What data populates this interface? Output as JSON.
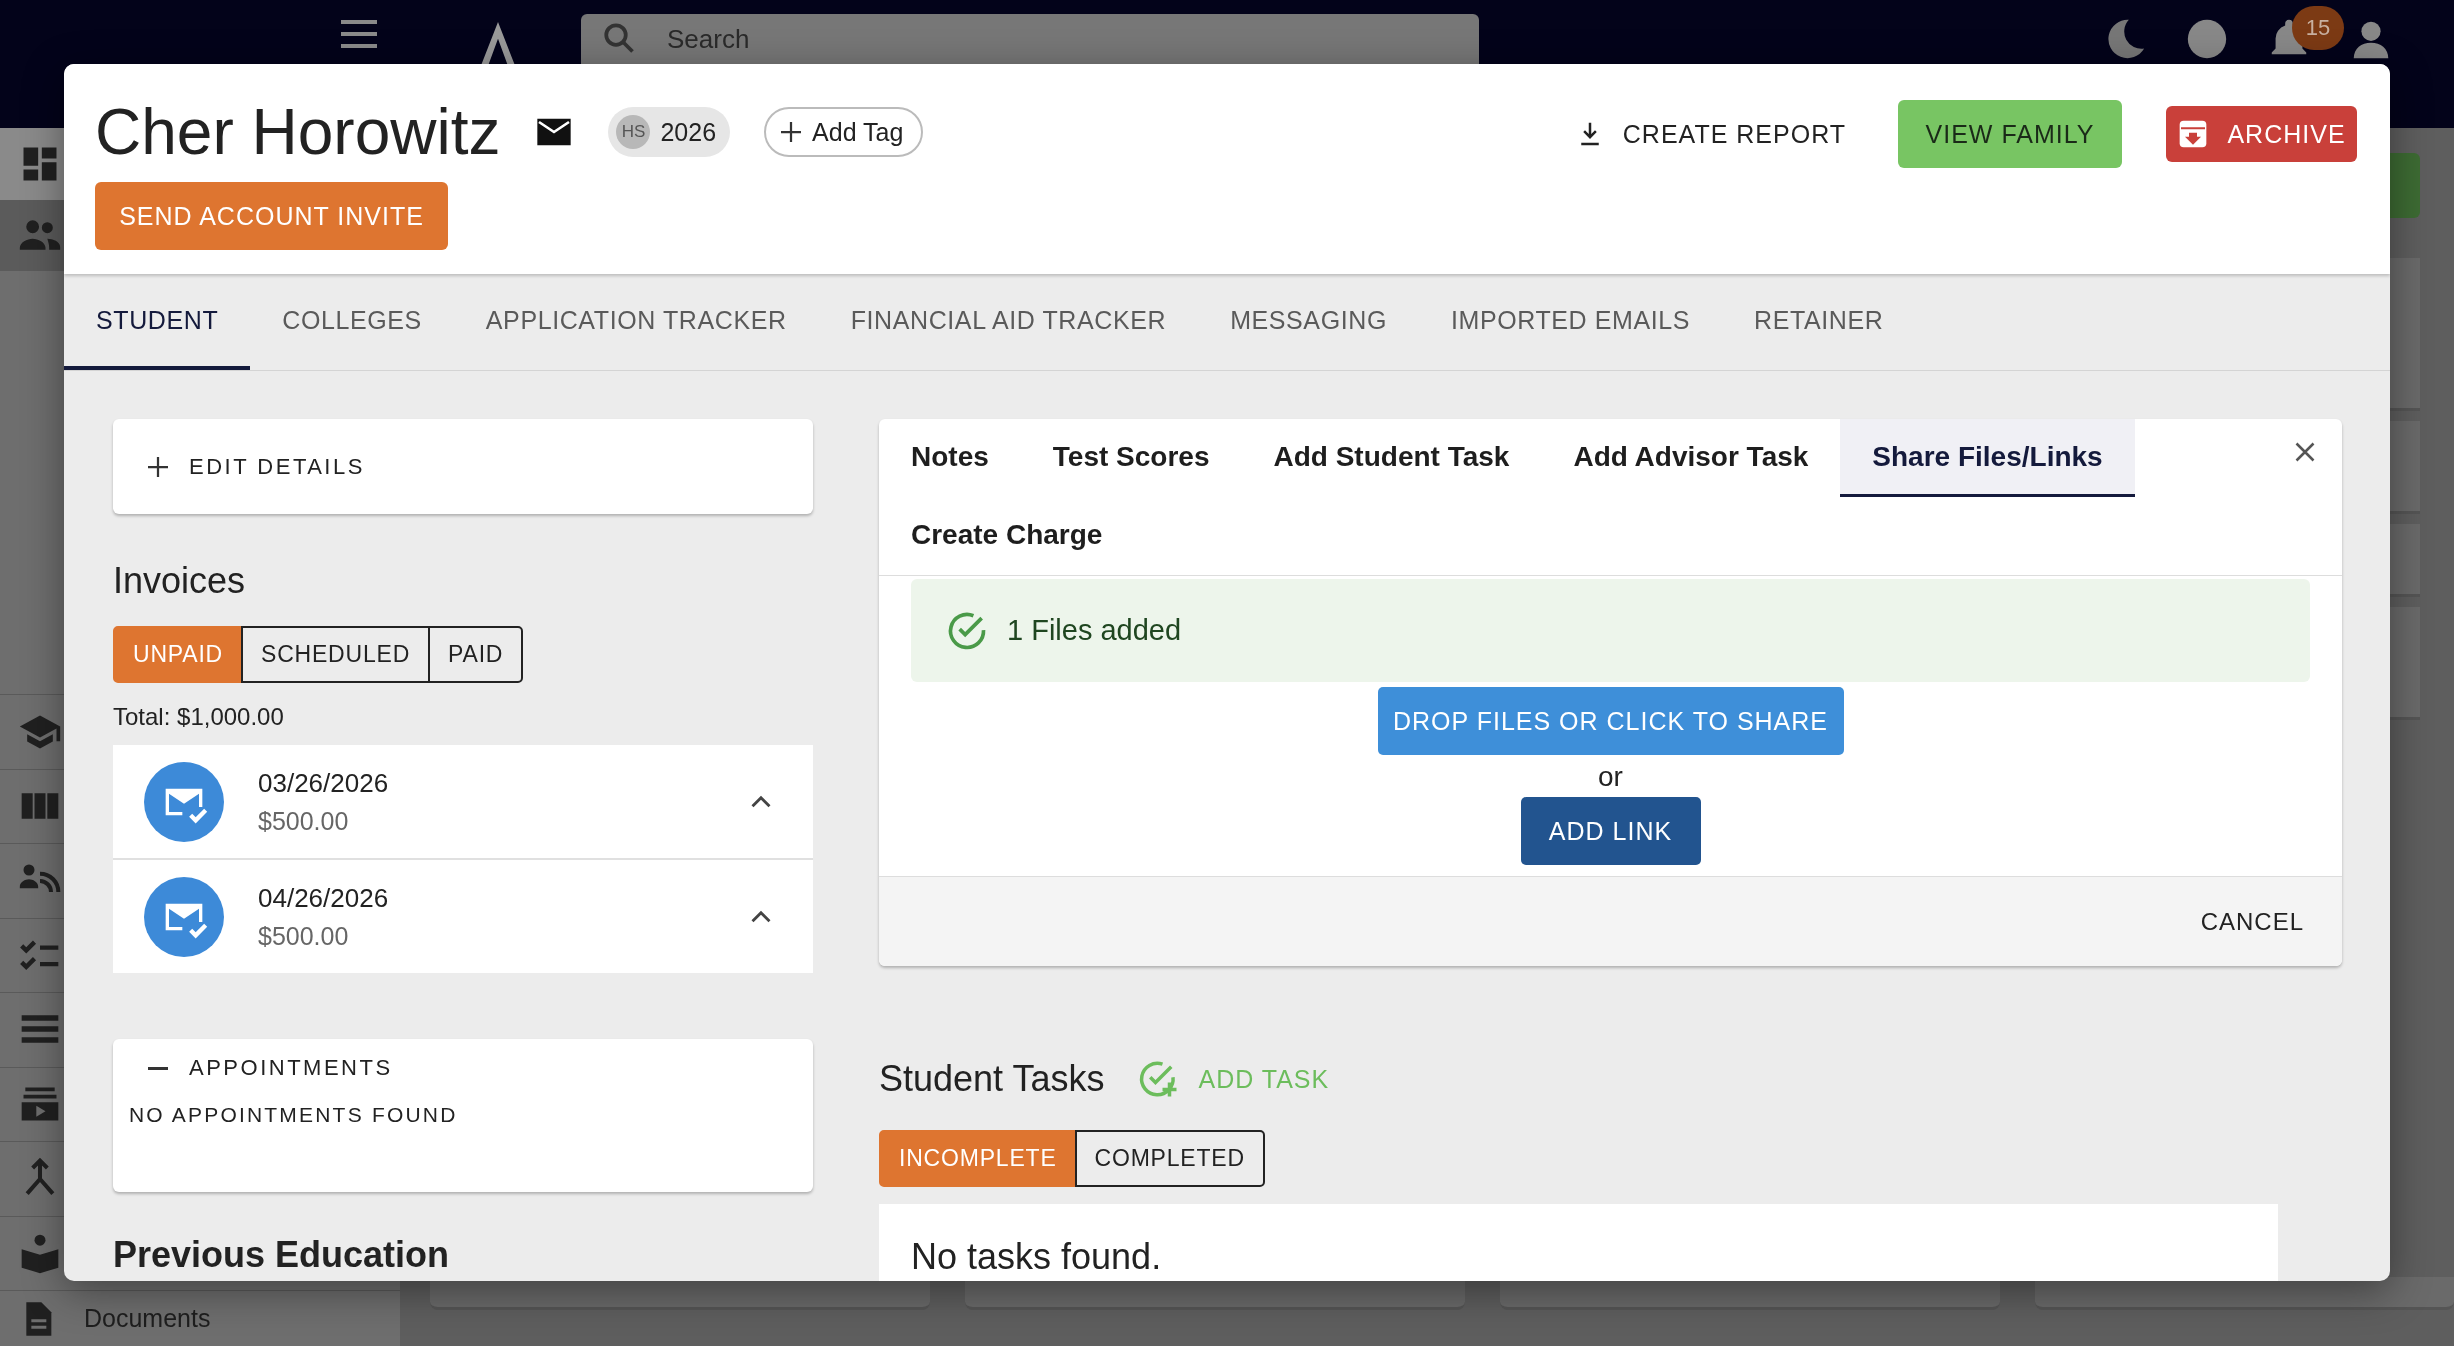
{
  "app_bar": {
    "search": {
      "placeholder": "Search"
    },
    "notification_count": "15"
  },
  "sidebar": {
    "items": [
      {
        "kind": "dashboard",
        "selected": false
      },
      {
        "kind": "people",
        "selected": true
      },
      {
        "kind": "school",
        "selected": false
      },
      {
        "kind": "columns",
        "selected": false
      },
      {
        "kind": "contacts",
        "selected": false
      },
      {
        "kind": "checklist",
        "selected": false
      },
      {
        "kind": "list",
        "selected": false
      },
      {
        "kind": "video",
        "selected": false
      },
      {
        "kind": "merge",
        "selected": false
      },
      {
        "kind": "reader",
        "selected": false
      },
      {
        "kind": "document",
        "label": "Documents",
        "selected": false
      }
    ]
  },
  "student": {
    "name": "Cher Horowitz",
    "chip": {
      "prefix": "HS",
      "label": "2026"
    },
    "add_tag": "Add Tag",
    "invite_button": "SEND ACCOUNT INVITE",
    "actions": [
      {
        "kind": "report",
        "label": "CREATE REPORT"
      },
      {
        "kind": "family",
        "label": "VIEW FAMILY"
      },
      {
        "kind": "archive",
        "label": "ARCHIVE"
      }
    ]
  },
  "tabs": [
    {
      "label": "STUDENT",
      "selected": true
    },
    {
      "label": "COLLEGES",
      "selected": false
    },
    {
      "label": "APPLICATION TRACKER",
      "selected": false
    },
    {
      "label": "FINANCIAL AID TRACKER",
      "selected": false
    },
    {
      "label": "MESSAGING",
      "selected": false
    },
    {
      "label": "IMPORTED EMAILS",
      "selected": false
    },
    {
      "label": "RETAINER",
      "selected": false
    }
  ],
  "edit_details": {
    "label": "EDIT DETAILS",
    "expanded": false
  },
  "invoices": {
    "title": "Invoices",
    "filters": [
      {
        "label": "UNPAID",
        "selected": true
      },
      {
        "label": "SCHEDULED",
        "selected": false
      },
      {
        "label": "PAID",
        "selected": false
      }
    ],
    "total": "Total: $1,000.00",
    "items": [
      {
        "date": "03/26/2026",
        "amount": "$500.00"
      },
      {
        "date": "04/26/2026",
        "amount": "$500.00"
      }
    ]
  },
  "appointments": {
    "title": "APPOINTMENTS",
    "expanded": true,
    "empty": "NO APPOINTMENTS FOUND"
  },
  "previous_education": {
    "title": "Previous Education"
  },
  "action_panel": {
    "tabs": [
      {
        "label": "Notes",
        "selected": false
      },
      {
        "label": "Test Scores",
        "selected": false
      },
      {
        "label": "Add Student Task",
        "selected": false
      },
      {
        "label": "Add Advisor Task",
        "selected": false
      },
      {
        "label": "Share Files/Links",
        "selected": true
      },
      {
        "label": "Create Charge",
        "selected": false
      }
    ],
    "alert": "1 Files added",
    "upload_button": "DROP FILES OR CLICK TO SHARE",
    "separator": "or",
    "link_button": "ADD LINK",
    "cancel": "CANCEL"
  },
  "student_tasks": {
    "title": "Student Tasks",
    "add": "ADD TASK",
    "filters": [
      {
        "label": "INCOMPLETE",
        "selected": true
      },
      {
        "label": "COMPLETED",
        "selected": false
      }
    ],
    "empty": "No tasks found."
  }
}
